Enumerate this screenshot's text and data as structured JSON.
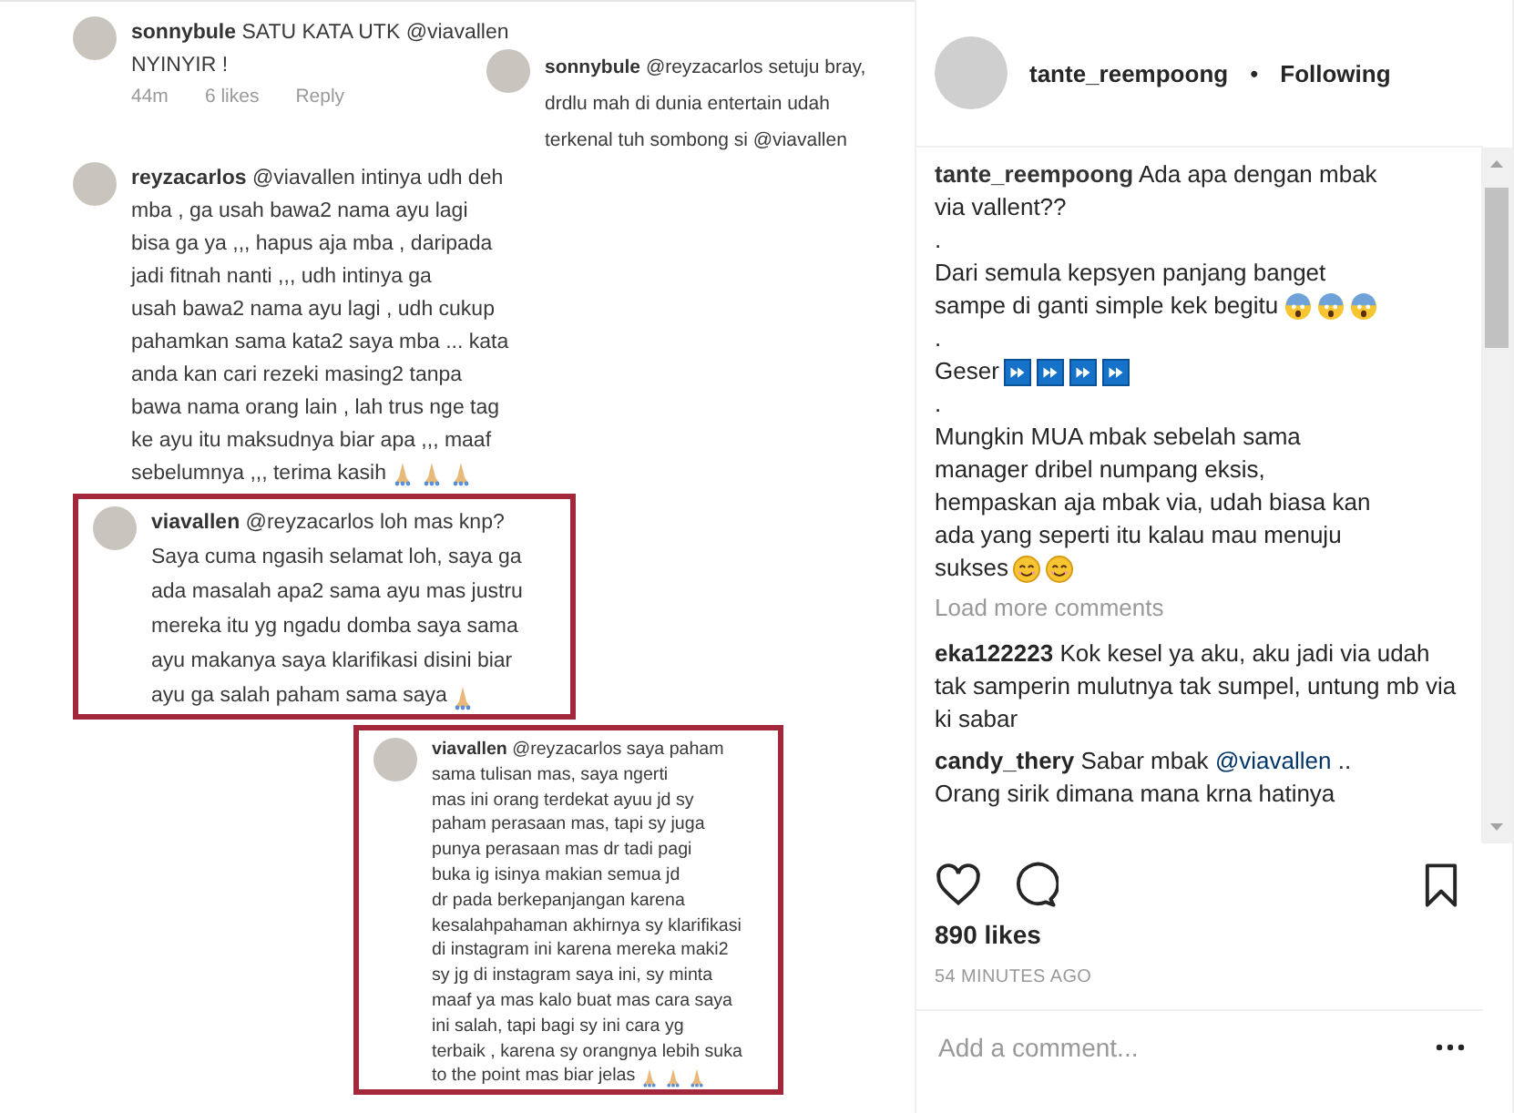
{
  "post_image": {
    "top_comment": {
      "username": "sonnybule",
      "lines": [
        "SATU KATA UTK @viavallen",
        "NYINYIR !"
      ],
      "meta": [
        "44m",
        "6 likes",
        "Reply"
      ]
    },
    "reply": {
      "username": "sonnybule",
      "lines": [
        "@reyzacarlos setuju bray,",
        "drdlu mah di dunia entertain udah",
        "terkenal tuh sombong si @viavallen"
      ]
    },
    "long_comment": {
      "username": "reyzacarlos",
      "lines": [
        "@viavallen intinya udh deh",
        "mba , ga usah bawa2 nama ayu lagi",
        "bisa ga ya ,,, hapus aja mba , daripada",
        "jadi fitnah nanti ,,, udh intinya ga",
        "usah bawa2 nama ayu lagi , udh cukup",
        "pahamkan sama kata2 saya mba ... kata",
        "anda kan cari rezeki masing2 tanpa",
        "bawa nama orang lain , lah trus nge tag",
        "ke ayu itu maksudnya biar apa ,,, maaf",
        "sebelumnya ,,, terima kasih"
      ],
      "icons": [
        {
          "kind": "pray"
        },
        {
          "kind": "pray"
        },
        {
          "kind": "pray"
        }
      ]
    },
    "highlighted_comments": [
      {
        "username": "viavallen",
        "lines": [
          "@reyzacarlos loh mas knp?",
          "Saya cuma ngasih selamat loh, saya ga",
          "ada masalah apa2 sama ayu mas justru",
          "mereka itu yg ngadu domba saya sama",
          "ayu makanya saya klarifikasi disini biar",
          "ayu ga salah paham sama saya"
        ],
        "icons": [
          {
            "kind": "pray"
          }
        ]
      },
      {
        "username": "viavallen",
        "lines": [
          "@reyzacarlos saya paham",
          "sama tulisan mas, saya ngerti",
          "mas ini orang terdekat ayuu jd sy",
          "paham perasaan mas, tapi sy juga",
          "punya perasaan mas dr tadi pagi",
          "buka ig isinya makian semua jd",
          "dr pada berkepanjangan karena",
          "kesalahpahaman akhirnya sy klarifikasi",
          "di instagram ini karena mereka maki2",
          "sy jg di instagram saya ini, sy minta",
          "maaf ya mas kalo buat mas cara saya",
          "ini salah, tapi bagi sy ini cara yg",
          "terbaik , karena sy orangnya lebih suka",
          "to the point mas biar jelas"
        ],
        "icons": [
          {
            "kind": "pray"
          },
          {
            "kind": "pray"
          },
          {
            "kind": "pray"
          }
        ]
      }
    ]
  },
  "header": {
    "username": "tante_reempoong",
    "separator": "•",
    "follow_status": "Following"
  },
  "caption": {
    "username": "tante_reempoong",
    "paragraphs": [
      {
        "lines": [
          "Ada apa dengan mbak",
          "via vallent??"
        ]
      },
      {
        "lines": [
          "."
        ]
      },
      {
        "lines": [
          "Dari semula kepsyen panjang banget",
          "sampe di ganti simple kek begitu"
        ],
        "icons": [
          {
            "kind": "scream"
          },
          {
            "kind": "scream"
          },
          {
            "kind": "scream"
          }
        ]
      },
      {
        "lines": [
          "."
        ]
      },
      {
        "lines": [
          "Geser"
        ],
        "icons": [
          {
            "kind": "forward"
          },
          {
            "kind": "forward"
          },
          {
            "kind": "forward"
          },
          {
            "kind": "forward"
          }
        ]
      },
      {
        "lines": [
          "."
        ]
      },
      {
        "lines": [
          "Mungkin MUA mbak sebelah sama",
          "manager dribel numpang eksis,",
          "hempaskan aja mbak via, udah biasa kan",
          "ada yang seperti itu kalau mau menuju",
          "sukses"
        ],
        "icons": [
          {
            "kind": "smile"
          },
          {
            "kind": "smile"
          }
        ]
      }
    ]
  },
  "load_more": "Load more comments",
  "comments": [
    {
      "username": "eka122223",
      "text": "Kok kesel ya aku, aku jadi via udah tak samperin mulutnya tak sumpel, untung mb via ki sabar"
    },
    {
      "username": "candy_thery",
      "text": "Sabar mbak",
      "mention": "@viavallen",
      "text_after": "..",
      "more": "Orang sirik dimana mana krna hatinya"
    }
  ],
  "likes": "890 likes",
  "timestamp": "54 MINUTES AGO",
  "comment_field": {
    "placeholder": "Add a comment..."
  }
}
